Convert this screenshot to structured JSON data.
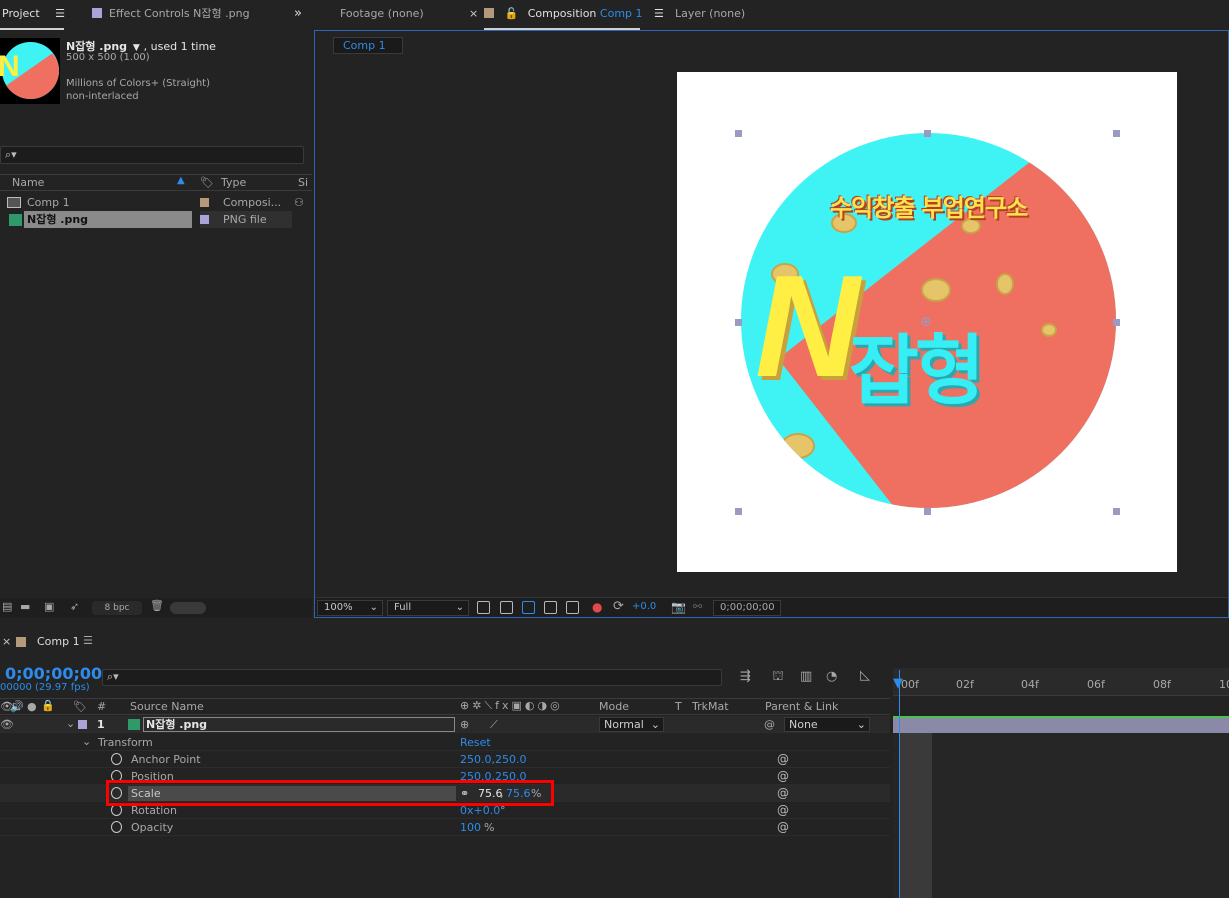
{
  "project_panel": {
    "tab_project": "Project",
    "tab_effect_controls": "Effect Controls",
    "effect_controls_target": "N잡형 .png",
    "asset_name": "N잡형 .png",
    "used_text": ", used 1 time",
    "dimensions": "500 x 500 (1.00)",
    "color_info": "Millions of Colors+ (Straight)",
    "interlace_info": "non-interlaced",
    "columns": [
      "Name",
      "Type",
      "Si"
    ],
    "items": [
      {
        "name": "Comp 1",
        "type": "Composi...",
        "swatch": "#b49a7a"
      },
      {
        "name": "N잡형 .png",
        "type": "PNG file",
        "swatch": "#a8a4d8"
      }
    ],
    "bpc": "8 bpc"
  },
  "viewer_tabs": {
    "footage": "Footage",
    "footage_value": "(none)",
    "composition": "Composition",
    "composition_value": "Comp 1",
    "layer": "Layer",
    "layer_value": "(none)",
    "flowchart_chip": "Comp 1"
  },
  "composition_art": {
    "title_text": "수익창출 부업연구소",
    "big_letter": "N",
    "korean_text": "잡형"
  },
  "viewer_controls": {
    "zoom": "100%",
    "resolution": "Full",
    "exposure": "+0.0",
    "timecode": "0;00;00;00"
  },
  "timeline": {
    "tab_label": "Comp 1",
    "timecode": "0;00;00;00",
    "fps": "00000 (29.97 fps)",
    "columns": {
      "num": "#",
      "source_name": "Source Name",
      "mode": "Mode",
      "t": "T",
      "trkmat": "TrkMat",
      "parent": "Parent & Link"
    },
    "layer": {
      "index": "1",
      "name": "N잡형 .png",
      "mode": "Normal",
      "parent": "None"
    },
    "transform": {
      "label": "Transform",
      "reset": "Reset",
      "props": [
        {
          "name": "Anchor Point",
          "value": "250.0,250.0"
        },
        {
          "name": "Position",
          "value": "250.0,250.0"
        },
        {
          "name": "Scale",
          "value_x": "75.6",
          "sep": ",",
          "value_y": "75.6",
          "unit": "%"
        },
        {
          "name": "Rotation",
          "value": "0x+0.0",
          "unit": "°"
        },
        {
          "name": "Opacity",
          "value": "100",
          "unit": "%"
        }
      ]
    },
    "ruler_ticks": [
      "00f",
      "02f",
      "04f",
      "06f",
      "08f",
      "10"
    ]
  }
}
